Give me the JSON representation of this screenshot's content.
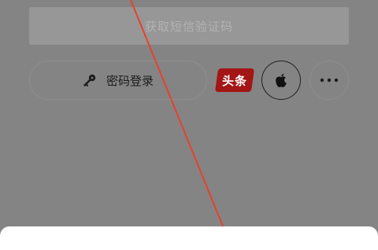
{
  "sms_button": {
    "label": "获取短信验证码"
  },
  "password_login": {
    "label": "密码登录",
    "icon": "key-icon"
  },
  "third_party": {
    "toutiao_label": "头条",
    "apple_icon": "apple-icon",
    "more_icon": "more-icon"
  },
  "colors": {
    "overlay": "#848484",
    "toutiao": "#a41515",
    "annotation_line": "#e8402b"
  }
}
